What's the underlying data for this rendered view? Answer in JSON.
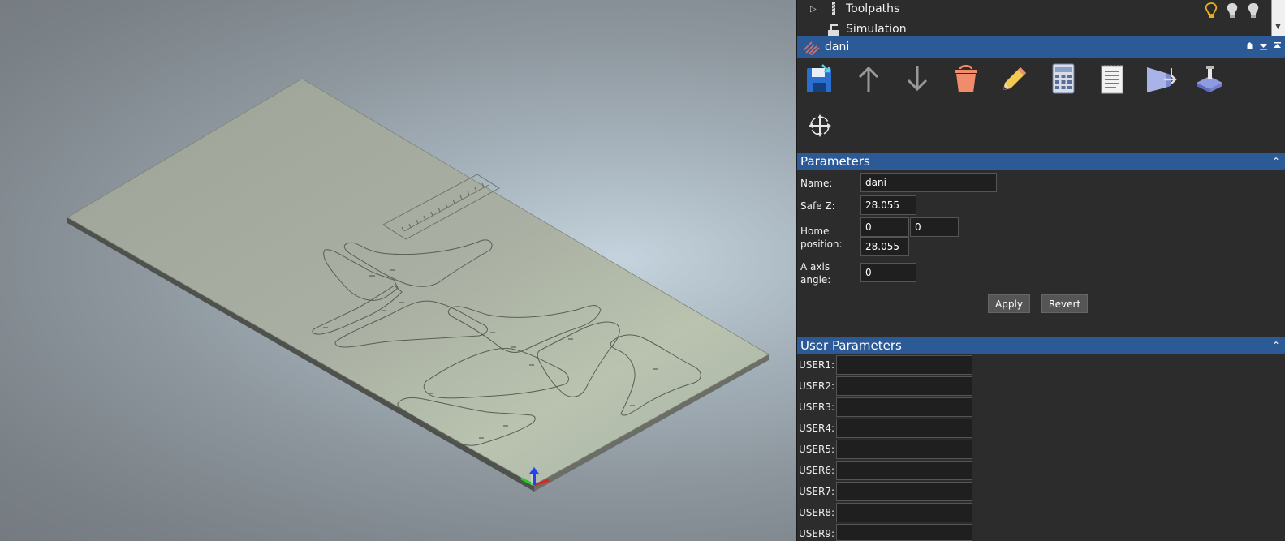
{
  "tree": {
    "items": [
      {
        "label": "Toolpaths",
        "icon": "endmill-icon"
      },
      {
        "label": "Simulation",
        "icon": "simulation-icon"
      }
    ]
  },
  "window": {
    "title": "dani",
    "icon": "toolpath-group-icon"
  },
  "toolbar": {
    "tools": [
      {
        "name": "save-icon"
      },
      {
        "name": "move-up-icon"
      },
      {
        "name": "move-down-icon"
      },
      {
        "name": "delete-bucket-icon"
      },
      {
        "name": "edit-pencil-icon"
      },
      {
        "name": "calculator-icon"
      },
      {
        "name": "notes-icon"
      },
      {
        "name": "post-process-icon"
      },
      {
        "name": "machine-icon"
      },
      {
        "name": "transform-icon"
      }
    ]
  },
  "parameters": {
    "header": "Parameters",
    "name_label": "Name:",
    "name_value": "dani",
    "safez_label": "Safe Z:",
    "safez_value": "28.055",
    "home_label": "Home position:",
    "home_x": "0",
    "home_y": "0",
    "home_z": "28.055",
    "aaxis_label": "A axis angle:",
    "aaxis_value": "0",
    "apply_label": "Apply",
    "revert_label": "Revert"
  },
  "user_parameters": {
    "header": "User Parameters",
    "items": [
      {
        "label": "USER1:",
        "value": ""
      },
      {
        "label": "USER2:",
        "value": ""
      },
      {
        "label": "USER3:",
        "value": ""
      },
      {
        "label": "USER4:",
        "value": ""
      },
      {
        "label": "USER5:",
        "value": ""
      },
      {
        "label": "USER6:",
        "value": ""
      },
      {
        "label": "USER7:",
        "value": ""
      },
      {
        "label": "USER8:",
        "value": ""
      },
      {
        "label": "USER9:",
        "value": ""
      }
    ]
  },
  "colors": {
    "accent": "#2b5a96",
    "panel_bg": "#2c2c2c",
    "stock": "#a4ab9e"
  }
}
